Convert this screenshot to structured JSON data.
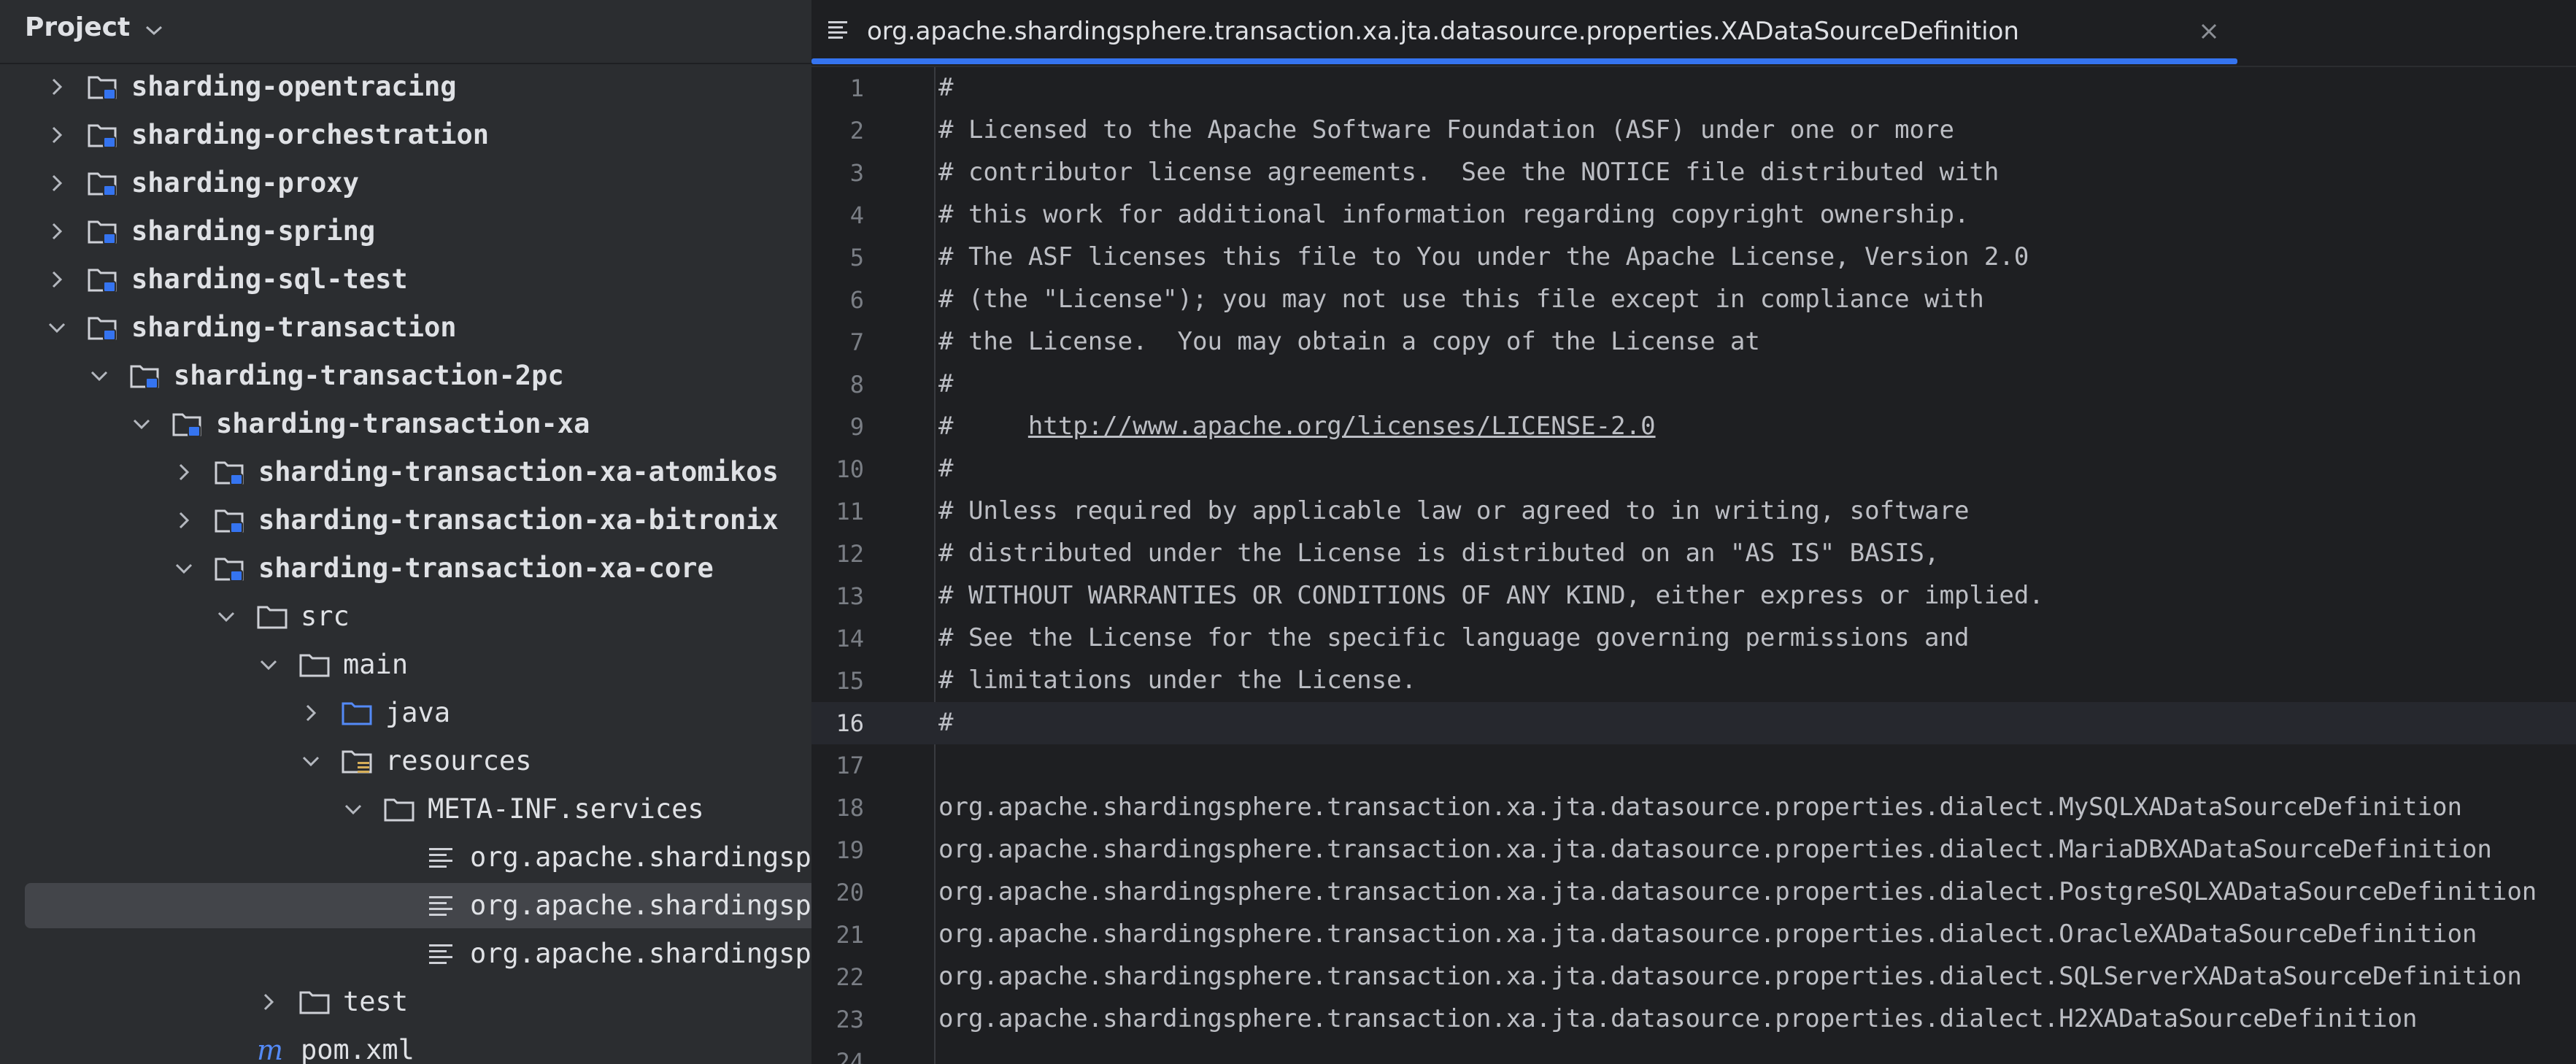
{
  "project_panel": {
    "title": "Project",
    "tree": [
      {
        "label": "sharding-opentracing",
        "depth": 0,
        "icon": "module-folder-icon",
        "arrow": "right",
        "bold": true
      },
      {
        "label": "sharding-orchestration",
        "depth": 0,
        "icon": "module-folder-icon",
        "arrow": "right",
        "bold": true
      },
      {
        "label": "sharding-proxy",
        "depth": 0,
        "icon": "module-folder-icon",
        "arrow": "right",
        "bold": true
      },
      {
        "label": "sharding-spring",
        "depth": 0,
        "icon": "module-folder-icon",
        "arrow": "right",
        "bold": true
      },
      {
        "label": "sharding-sql-test",
        "depth": 0,
        "icon": "module-folder-icon",
        "arrow": "right",
        "bold": true
      },
      {
        "label": "sharding-transaction",
        "depth": 0,
        "icon": "module-folder-icon",
        "arrow": "down",
        "bold": true
      },
      {
        "label": "sharding-transaction-2pc",
        "depth": 1,
        "icon": "module-folder-icon",
        "arrow": "down",
        "bold": true
      },
      {
        "label": "sharding-transaction-xa",
        "depth": 2,
        "icon": "module-folder-icon",
        "arrow": "down",
        "bold": true
      },
      {
        "label": "sharding-transaction-xa-atomikos",
        "depth": 3,
        "icon": "module-folder-icon",
        "arrow": "right",
        "bold": true
      },
      {
        "label": "sharding-transaction-xa-bitronix",
        "depth": 3,
        "icon": "module-folder-icon",
        "arrow": "right",
        "bold": true
      },
      {
        "label": "sharding-transaction-xa-core",
        "depth": 3,
        "icon": "module-folder-icon",
        "arrow": "down",
        "bold": true
      },
      {
        "label": "src",
        "depth": 4,
        "icon": "folder-icon",
        "arrow": "down",
        "bold": false
      },
      {
        "label": "main",
        "depth": 5,
        "icon": "folder-icon",
        "arrow": "down",
        "bold": false
      },
      {
        "label": "java",
        "depth": 6,
        "icon": "source-folder-icon",
        "arrow": "right",
        "bold": false
      },
      {
        "label": "resources",
        "depth": 6,
        "icon": "resources-folder-icon",
        "arrow": "down",
        "bold": false
      },
      {
        "label": "META-INF.services",
        "depth": 7,
        "icon": "folder-icon",
        "arrow": "down",
        "bold": false
      },
      {
        "label": "org.apache.shardingsphere.transaction.xa.jta.datasource.properties.XADataSourceDefinition",
        "depth": 8,
        "icon": "text-file-icon",
        "arrow": "none",
        "bold": false
      },
      {
        "label": "org.apache.shardingsphere.transaction.xa.jta.datasource.properties.XADataSourceDefinition",
        "depth": 8,
        "icon": "text-file-icon",
        "arrow": "none",
        "bold": false,
        "selected": true
      },
      {
        "label": "org.apache.shardingsphere.transaction.xa.jta.datasource.properties.XADataSourceDefinition",
        "depth": 8,
        "icon": "text-file-icon",
        "arrow": "none",
        "bold": false
      },
      {
        "label": "test",
        "depth": 5,
        "icon": "folder-icon",
        "arrow": "right",
        "bold": false
      },
      {
        "label": "pom.xml",
        "depth": 4,
        "icon": "maven-icon",
        "arrow": "none",
        "bold": false
      }
    ]
  },
  "editor": {
    "tab": {
      "title": "org.apache.shardingsphere.transaction.xa.jta.datasource.properties.XADataSourceDefinition"
    },
    "current_line": 16,
    "lines": [
      {
        "num": "1",
        "text": "#"
      },
      {
        "num": "2",
        "text": "# Licensed to the Apache Software Foundation (ASF) under one or more"
      },
      {
        "num": "3",
        "text": "# contributor license agreements.  See the NOTICE file distributed with"
      },
      {
        "num": "4",
        "text": "# this work for additional information regarding copyright ownership."
      },
      {
        "num": "5",
        "text": "# The ASF licenses this file to You under the Apache License, Version 2.0"
      },
      {
        "num": "6",
        "text": "# (the \"License\"); you may not use this file except in compliance with"
      },
      {
        "num": "7",
        "text": "# the License.  You may obtain a copy of the License at"
      },
      {
        "num": "8",
        "text": "#"
      },
      {
        "num": "9",
        "text": "#     ",
        "link": "http://www.apache.org/licenses/LICENSE-2.0"
      },
      {
        "num": "10",
        "text": "#"
      },
      {
        "num": "11",
        "text": "# Unless required by applicable law or agreed to in writing, software"
      },
      {
        "num": "12",
        "text": "# distributed under the License is distributed on an \"AS IS\" BASIS,"
      },
      {
        "num": "13",
        "text": "# WITHOUT WARRANTIES OR CONDITIONS OF ANY KIND, either express or implied."
      },
      {
        "num": "14",
        "text": "# See the License for the specific language governing permissions and"
      },
      {
        "num": "15",
        "text": "# limitations under the License."
      },
      {
        "num": "16",
        "text": "#"
      },
      {
        "num": "17",
        "text": ""
      },
      {
        "num": "18",
        "text": "org.apache.shardingsphere.transaction.xa.jta.datasource.properties.dialect.MySQLXADataSourceDefinition"
      },
      {
        "num": "19",
        "text": "org.apache.shardingsphere.transaction.xa.jta.datasource.properties.dialect.MariaDBXADataSourceDefinition"
      },
      {
        "num": "20",
        "text": "org.apache.shardingsphere.transaction.xa.jta.datasource.properties.dialect.PostgreSQLXADataSourceDefinition"
      },
      {
        "num": "21",
        "text": "org.apache.shardingsphere.transaction.xa.jta.datasource.properties.dialect.OracleXADataSourceDefinition"
      },
      {
        "num": "22",
        "text": "org.apache.shardingsphere.transaction.xa.jta.datasource.properties.dialect.SQLServerXADataSourceDefinition"
      },
      {
        "num": "23",
        "text": "org.apache.shardingsphere.transaction.xa.jta.datasource.properties.dialect.H2XADataSourceDefinition"
      },
      {
        "num": "24",
        "text": ""
      }
    ]
  },
  "colors": {
    "accent": "#3574f0",
    "panel_bg": "#2b2d30",
    "editor_bg": "#1e1f22"
  }
}
